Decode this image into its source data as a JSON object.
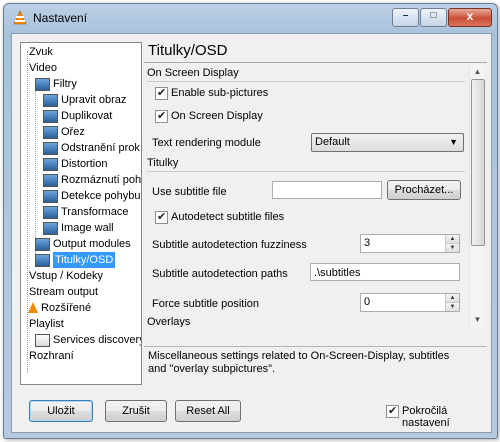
{
  "window": {
    "title": "Nastavení",
    "controls": {
      "minimize": "–",
      "maximize": "□",
      "close": "x"
    }
  },
  "tree": {
    "items": [
      {
        "label": "Zvuk",
        "icon": "audio-icon"
      },
      {
        "label": "Video",
        "icon": "video-icon"
      },
      {
        "label": "Filtry",
        "icon": "filter-icon"
      },
      {
        "label": "Upravit obraz",
        "icon": "module-icon"
      },
      {
        "label": "Duplikovat",
        "icon": "module-icon"
      },
      {
        "label": "Ořez",
        "icon": "module-icon"
      },
      {
        "label": "Odstranění prok",
        "icon": "module-icon"
      },
      {
        "label": "Distortion",
        "icon": "module-icon"
      },
      {
        "label": "Rozmáznutí poh",
        "icon": "module-icon"
      },
      {
        "label": "Detekce pohybu",
        "icon": "module-icon"
      },
      {
        "label": "Transformace",
        "icon": "module-icon"
      },
      {
        "label": "Image wall",
        "icon": "module-icon"
      },
      {
        "label": "Output modules",
        "icon": "module-icon"
      },
      {
        "label": "Titulky/OSD",
        "icon": "module-icon"
      },
      {
        "label": "Vstup / Kodeky",
        "icon": "module-icon"
      },
      {
        "label": "Stream output",
        "icon": "module-icon"
      },
      {
        "label": "Rozšířené",
        "icon": "vlc-cone-icon"
      },
      {
        "label": "Playlist",
        "icon": "module-icon"
      },
      {
        "label": "Services discovery",
        "icon": "module-icon"
      },
      {
        "label": "Rozhraní",
        "icon": "module-icon"
      }
    ],
    "selected": "Titulky/OSD"
  },
  "panel": {
    "title": "Titulky/OSD",
    "sections": {
      "osd": "On Screen Display",
      "subtitles": "Titulky",
      "overlays": "Overlays"
    },
    "enable_subpictures": {
      "label": "Enable sub-pictures",
      "checked": true
    },
    "on_screen_display": {
      "label": "On Screen Display",
      "checked": true
    },
    "text_rendering": {
      "label": "Text rendering module",
      "value": "Default"
    },
    "subtitle_file": {
      "label": "Use subtitle file",
      "value": "",
      "browse": "Procházet..."
    },
    "autodetect": {
      "label": "Autodetect subtitle files",
      "checked": true
    },
    "fuzziness": {
      "label": "Subtitle autodetection fuzziness",
      "value": "3"
    },
    "paths": {
      "label": "Subtitle autodetection paths",
      "value": ".\\subtitles"
    },
    "force_position": {
      "label": "Force subtitle position",
      "value": "0"
    }
  },
  "help": {
    "text": "Miscellaneous settings related to On-Screen-Display, subtitles and \"overlay subpictures\"."
  },
  "buttons": {
    "save": "Uložit",
    "cancel": "Zrušit",
    "reset": "Reset All"
  },
  "advanced": {
    "label": "Pokročilá nastavení",
    "checked": true
  }
}
